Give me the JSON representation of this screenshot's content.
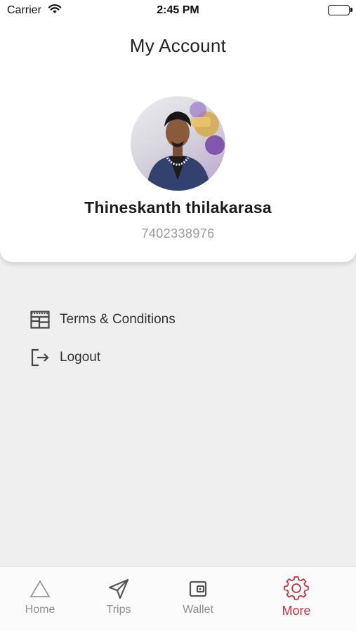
{
  "status_bar": {
    "carrier": "Carrier",
    "time": "2:45 PM"
  },
  "header": {
    "title": "My Account"
  },
  "profile": {
    "name": "Thineskanth thilakarasa",
    "phone": "7402338976"
  },
  "menu": {
    "items": [
      {
        "label": "Terms & Conditions",
        "icon": "document-icon"
      },
      {
        "label": "Logout",
        "icon": "logout-icon"
      }
    ]
  },
  "tabs": [
    {
      "label": "Home",
      "icon": "home-triangle-icon"
    },
    {
      "label": "Trips",
      "icon": "paper-plane-icon"
    },
    {
      "label": "Wallet",
      "icon": "wallet-icon"
    },
    {
      "label": "More",
      "icon": "gear-icon",
      "active": true
    }
  ],
  "colors": {
    "accent": "#c8313b",
    "background": "#efefef",
    "card": "#ffffff"
  }
}
